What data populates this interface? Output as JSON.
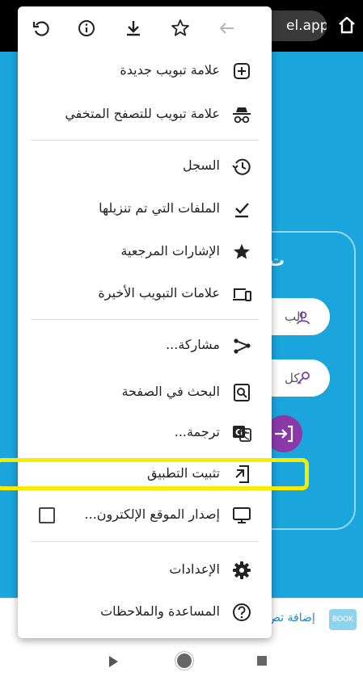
{
  "background": {
    "url_text": "el.app",
    "login_title_fragment": "ت",
    "field1_fragment": "الب",
    "field2_fragment": "كل",
    "promo_text": "إضافة تص",
    "promo_logo_text": "BOOK",
    "colors": {
      "page_blue": "#1aa5dd",
      "accent_purple": "#8a3aa8",
      "highlight_yellow": "#f5ec00"
    }
  },
  "menu": {
    "toolbar": [
      {
        "name": "forward-icon"
      },
      {
        "name": "bookmark-star-icon"
      },
      {
        "name": "download-icon"
      },
      {
        "name": "info-icon"
      },
      {
        "name": "reload-icon"
      }
    ],
    "items": [
      {
        "id": "new-tab",
        "label": "علامة تبويب جديدة",
        "icon": "plus-box-icon"
      },
      {
        "id": "incognito",
        "label": "علامة تبويب للتصفح المتخفي",
        "icon": "incognito-icon"
      },
      {
        "id": "history",
        "label": "السجل",
        "icon": "history-icon"
      },
      {
        "id": "downloads",
        "label": "الملفات التي تم تنزيلها",
        "icon": "download-done-icon"
      },
      {
        "id": "bookmarks",
        "label": "الإشارات المرجعية",
        "icon": "star-filled-icon"
      },
      {
        "id": "recent-tabs",
        "label": "علامات التبويب الأخيرة",
        "icon": "devices-icon"
      },
      {
        "id": "share",
        "label": "مشاركة...",
        "icon": "share-icon"
      },
      {
        "id": "find",
        "label": "البحث في الصفحة",
        "icon": "find-in-page-icon"
      },
      {
        "id": "translate",
        "label": "ترجمة...",
        "icon": "translate-icon"
      },
      {
        "id": "install-app",
        "label": "تثبيت التطبيق",
        "icon": "install-app-icon"
      },
      {
        "id": "desktop-site",
        "label": "إصدار الموقع الإلكترون...",
        "icon": "desktop-icon",
        "checked": false
      },
      {
        "id": "settings",
        "label": "الإعدادات",
        "icon": "gear-icon"
      },
      {
        "id": "help",
        "label": "المساعدة والملاحظات",
        "icon": "help-icon"
      }
    ]
  }
}
